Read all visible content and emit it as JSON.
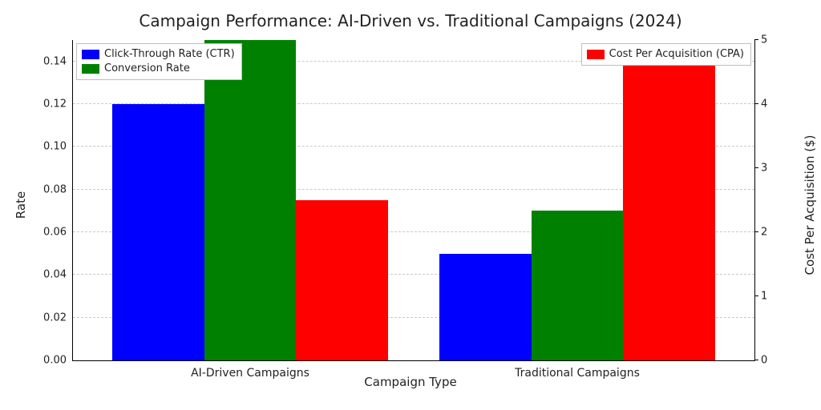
{
  "chart_data": {
    "type": "bar",
    "title": "Campaign Performance: AI-Driven vs. Traditional Campaigns (2024)",
    "xlabel": "Campaign Type",
    "ylabel_left": "Rate",
    "ylabel_right": "Cost Per Acquisition ($)",
    "categories": [
      "AI-Driven Campaigns",
      "Traditional Campaigns"
    ],
    "series": [
      {
        "name": "Click-Through Rate (CTR)",
        "axis": "left",
        "color": "#0000ff",
        "values": [
          0.12,
          0.05
        ]
      },
      {
        "name": "Conversion Rate",
        "axis": "left",
        "color": "#008000",
        "values": [
          0.15,
          0.07
        ]
      },
      {
        "name": "Cost Per Acquisition (CPA)",
        "axis": "right",
        "color": "#ff0000",
        "values": [
          2.5,
          4.9
        ]
      }
    ],
    "ylim_left": [
      0.0,
      0.15
    ],
    "yticks_left": [
      "0.00",
      "0.02",
      "0.04",
      "0.06",
      "0.08",
      "0.10",
      "0.12",
      "0.14"
    ],
    "ylim_right": [
      0,
      5
    ],
    "yticks_right": [
      "0",
      "1",
      "2",
      "3",
      "4",
      "5"
    ],
    "legend_left_position": "upper-left",
    "legend_right_position": "upper-right"
  },
  "colors": {
    "ctr": "#0000ff",
    "conv": "#008000",
    "cpa": "#ff0000"
  },
  "legend_left": {
    "row0": "Click-Through Rate (CTR)",
    "row1": "Conversion Rate"
  },
  "legend_right": {
    "row0": "Cost Per Acquisition (CPA)"
  }
}
